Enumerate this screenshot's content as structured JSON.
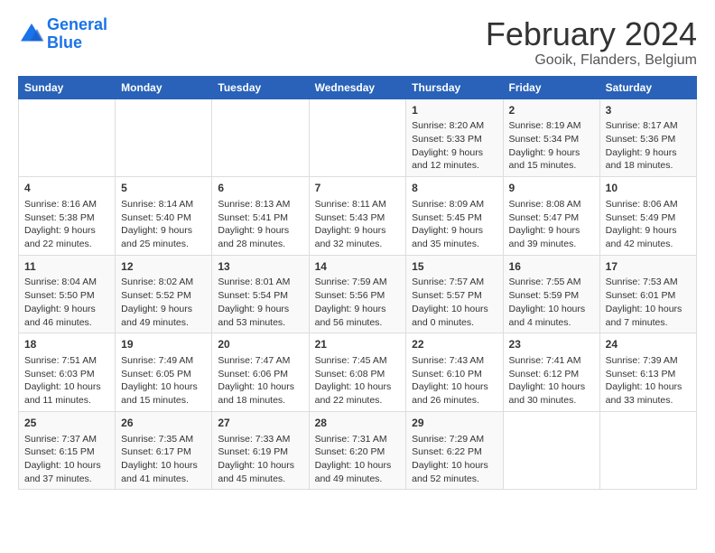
{
  "logo": {
    "line1": "General",
    "line2": "Blue"
  },
  "title": "February 2024",
  "subtitle": "Gooik, Flanders, Belgium",
  "days_of_week": [
    "Sunday",
    "Monday",
    "Tuesday",
    "Wednesday",
    "Thursday",
    "Friday",
    "Saturday"
  ],
  "weeks": [
    [
      {
        "day": "",
        "sunrise": "",
        "sunset": "",
        "daylight": ""
      },
      {
        "day": "",
        "sunrise": "",
        "sunset": "",
        "daylight": ""
      },
      {
        "day": "",
        "sunrise": "",
        "sunset": "",
        "daylight": ""
      },
      {
        "day": "",
        "sunrise": "",
        "sunset": "",
        "daylight": ""
      },
      {
        "day": "1",
        "sunrise": "Sunrise: 8:20 AM",
        "sunset": "Sunset: 5:33 PM",
        "daylight": "Daylight: 9 hours and 12 minutes."
      },
      {
        "day": "2",
        "sunrise": "Sunrise: 8:19 AM",
        "sunset": "Sunset: 5:34 PM",
        "daylight": "Daylight: 9 hours and 15 minutes."
      },
      {
        "day": "3",
        "sunrise": "Sunrise: 8:17 AM",
        "sunset": "Sunset: 5:36 PM",
        "daylight": "Daylight: 9 hours and 18 minutes."
      }
    ],
    [
      {
        "day": "4",
        "sunrise": "Sunrise: 8:16 AM",
        "sunset": "Sunset: 5:38 PM",
        "daylight": "Daylight: 9 hours and 22 minutes."
      },
      {
        "day": "5",
        "sunrise": "Sunrise: 8:14 AM",
        "sunset": "Sunset: 5:40 PM",
        "daylight": "Daylight: 9 hours and 25 minutes."
      },
      {
        "day": "6",
        "sunrise": "Sunrise: 8:13 AM",
        "sunset": "Sunset: 5:41 PM",
        "daylight": "Daylight: 9 hours and 28 minutes."
      },
      {
        "day": "7",
        "sunrise": "Sunrise: 8:11 AM",
        "sunset": "Sunset: 5:43 PM",
        "daylight": "Daylight: 9 hours and 32 minutes."
      },
      {
        "day": "8",
        "sunrise": "Sunrise: 8:09 AM",
        "sunset": "Sunset: 5:45 PM",
        "daylight": "Daylight: 9 hours and 35 minutes."
      },
      {
        "day": "9",
        "sunrise": "Sunrise: 8:08 AM",
        "sunset": "Sunset: 5:47 PM",
        "daylight": "Daylight: 9 hours and 39 minutes."
      },
      {
        "day": "10",
        "sunrise": "Sunrise: 8:06 AM",
        "sunset": "Sunset: 5:49 PM",
        "daylight": "Daylight: 9 hours and 42 minutes."
      }
    ],
    [
      {
        "day": "11",
        "sunrise": "Sunrise: 8:04 AM",
        "sunset": "Sunset: 5:50 PM",
        "daylight": "Daylight: 9 hours and 46 minutes."
      },
      {
        "day": "12",
        "sunrise": "Sunrise: 8:02 AM",
        "sunset": "Sunset: 5:52 PM",
        "daylight": "Daylight: 9 hours and 49 minutes."
      },
      {
        "day": "13",
        "sunrise": "Sunrise: 8:01 AM",
        "sunset": "Sunset: 5:54 PM",
        "daylight": "Daylight: 9 hours and 53 minutes."
      },
      {
        "day": "14",
        "sunrise": "Sunrise: 7:59 AM",
        "sunset": "Sunset: 5:56 PM",
        "daylight": "Daylight: 9 hours and 56 minutes."
      },
      {
        "day": "15",
        "sunrise": "Sunrise: 7:57 AM",
        "sunset": "Sunset: 5:57 PM",
        "daylight": "Daylight: 10 hours and 0 minutes."
      },
      {
        "day": "16",
        "sunrise": "Sunrise: 7:55 AM",
        "sunset": "Sunset: 5:59 PM",
        "daylight": "Daylight: 10 hours and 4 minutes."
      },
      {
        "day": "17",
        "sunrise": "Sunrise: 7:53 AM",
        "sunset": "Sunset: 6:01 PM",
        "daylight": "Daylight: 10 hours and 7 minutes."
      }
    ],
    [
      {
        "day": "18",
        "sunrise": "Sunrise: 7:51 AM",
        "sunset": "Sunset: 6:03 PM",
        "daylight": "Daylight: 10 hours and 11 minutes."
      },
      {
        "day": "19",
        "sunrise": "Sunrise: 7:49 AM",
        "sunset": "Sunset: 6:05 PM",
        "daylight": "Daylight: 10 hours and 15 minutes."
      },
      {
        "day": "20",
        "sunrise": "Sunrise: 7:47 AM",
        "sunset": "Sunset: 6:06 PM",
        "daylight": "Daylight: 10 hours and 18 minutes."
      },
      {
        "day": "21",
        "sunrise": "Sunrise: 7:45 AM",
        "sunset": "Sunset: 6:08 PM",
        "daylight": "Daylight: 10 hours and 22 minutes."
      },
      {
        "day": "22",
        "sunrise": "Sunrise: 7:43 AM",
        "sunset": "Sunset: 6:10 PM",
        "daylight": "Daylight: 10 hours and 26 minutes."
      },
      {
        "day": "23",
        "sunrise": "Sunrise: 7:41 AM",
        "sunset": "Sunset: 6:12 PM",
        "daylight": "Daylight: 10 hours and 30 minutes."
      },
      {
        "day": "24",
        "sunrise": "Sunrise: 7:39 AM",
        "sunset": "Sunset: 6:13 PM",
        "daylight": "Daylight: 10 hours and 33 minutes."
      }
    ],
    [
      {
        "day": "25",
        "sunrise": "Sunrise: 7:37 AM",
        "sunset": "Sunset: 6:15 PM",
        "daylight": "Daylight: 10 hours and 37 minutes."
      },
      {
        "day": "26",
        "sunrise": "Sunrise: 7:35 AM",
        "sunset": "Sunset: 6:17 PM",
        "daylight": "Daylight: 10 hours and 41 minutes."
      },
      {
        "day": "27",
        "sunrise": "Sunrise: 7:33 AM",
        "sunset": "Sunset: 6:19 PM",
        "daylight": "Daylight: 10 hours and 45 minutes."
      },
      {
        "day": "28",
        "sunrise": "Sunrise: 7:31 AM",
        "sunset": "Sunset: 6:20 PM",
        "daylight": "Daylight: 10 hours and 49 minutes."
      },
      {
        "day": "29",
        "sunrise": "Sunrise: 7:29 AM",
        "sunset": "Sunset: 6:22 PM",
        "daylight": "Daylight: 10 hours and 52 minutes."
      },
      {
        "day": "",
        "sunrise": "",
        "sunset": "",
        "daylight": ""
      },
      {
        "day": "",
        "sunrise": "",
        "sunset": "",
        "daylight": ""
      }
    ]
  ]
}
